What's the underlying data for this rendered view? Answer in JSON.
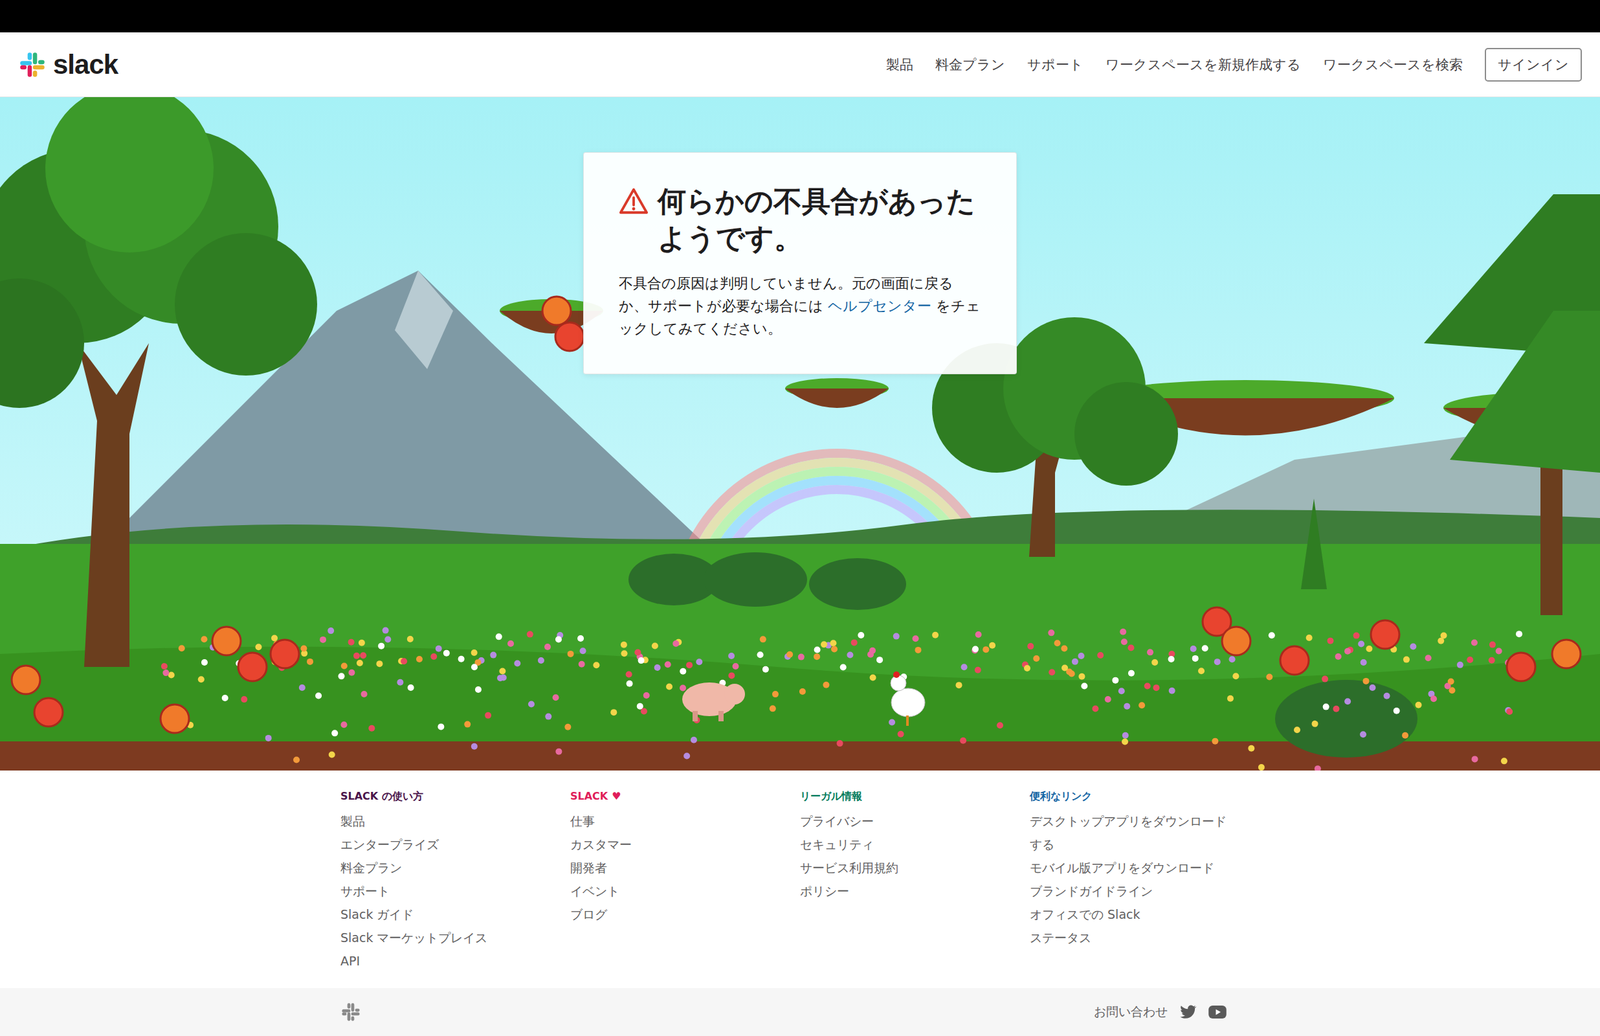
{
  "header": {
    "logo": "slack",
    "nav": [
      "製品",
      "料金プラン",
      "サポート",
      "ワークスペースを新規作成する",
      "ワークスペースを検索"
    ],
    "signin": "サインイン"
  },
  "error": {
    "title": "何らかの不具合があったようです。",
    "body_before": "不具合の原因は判明していません。元の画面に戻るか、サポートが必要な場合には ",
    "link": "ヘルプセンター",
    "body_after": " をチェックしてみてください。"
  },
  "footer": {
    "columns": [
      {
        "heading": "SLACK の使い方",
        "mark": "",
        "color": "#4a154b",
        "links": [
          "製品",
          "エンタープライズ",
          "料金プラン",
          "サポート",
          "Slack ガイド",
          "Slack マーケットプレイス",
          "API"
        ]
      },
      {
        "heading": "SLACK",
        "mark": "♥",
        "color": "#e01e5a",
        "links": [
          "仕事",
          "カスタマー",
          "開発者",
          "イベント",
          "ブログ"
        ]
      },
      {
        "heading": "リーガル情報",
        "mark": "",
        "color": "#007a5a",
        "links": [
          "プライバシー",
          "セキュリティ",
          "サービス利用規約",
          "ポリシー"
        ]
      },
      {
        "heading": "便利なリンク",
        "mark": "",
        "color": "#1264a3",
        "links": [
          "デスクトップアプリをダウンロードする",
          "モバイル版アプリをダウンロード",
          "ブランドガイドライン",
          "オフィスでの Slack",
          "ステータス"
        ]
      }
    ]
  },
  "bottom_bar": {
    "contact": "お問い合わせ"
  }
}
